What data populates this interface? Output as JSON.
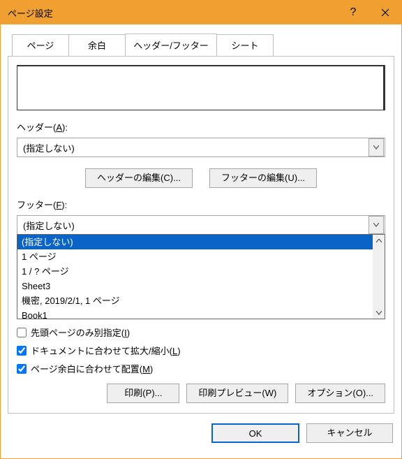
{
  "window": {
    "title": "ページ設定",
    "help_icon": "?",
    "close_icon": "✕"
  },
  "tabs": {
    "page": "ページ",
    "margins": "余白",
    "header_footer": "ヘッダー/フッター",
    "sheet": "シート"
  },
  "header": {
    "label_prefix": "ヘッダー(",
    "label_accel": "A",
    "label_suffix": "):",
    "value": "(指定しない)"
  },
  "edit_buttons": {
    "edit_header_prefix": "ヘッダーの編集(",
    "edit_header_accel": "C",
    "edit_header_suffix": ")...",
    "edit_footer_prefix": "フッターの編集(",
    "edit_footer_accel": "U",
    "edit_footer_suffix": ")..."
  },
  "footer": {
    "label_prefix": "フッター(",
    "label_accel": "F",
    "label_suffix": "):",
    "value": "(指定しない)",
    "options": [
      "(指定しない)",
      "1 ページ",
      "1 / ? ページ",
      "Sheet3",
      " 機密, 2019/2/1, 1 ページ",
      "Book1"
    ],
    "selected_index": 0
  },
  "checks": {
    "diff_first_prefix": "先頭ページのみ別指定(",
    "diff_first_accel": "I",
    "diff_first_suffix": ")",
    "diff_first_checked": false,
    "scale_prefix": "ドキュメントに合わせて拡大/縮小(",
    "scale_accel": "L",
    "scale_suffix": ")",
    "scale_checked": true,
    "align_prefix": "ページ余白に合わせて配置(",
    "align_accel": "M",
    "align_suffix": ")",
    "align_checked": true
  },
  "action_buttons": {
    "print_prefix": "印刷(",
    "print_accel": "P",
    "print_suffix": ")...",
    "preview_prefix": "印刷プレビュー(",
    "preview_accel": "W",
    "preview_suffix": ")",
    "options_prefix": "オプション(",
    "options_accel": "O",
    "options_suffix": ")..."
  },
  "bottom": {
    "ok": "OK",
    "cancel": "キャンセル"
  }
}
